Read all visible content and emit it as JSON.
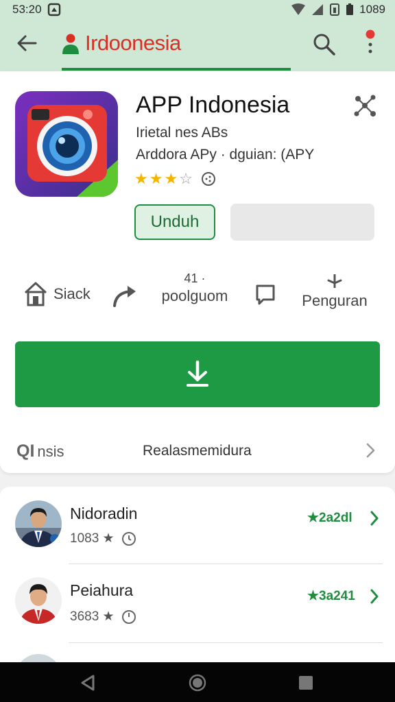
{
  "status_bar": {
    "time": "53:20",
    "battery": "1089"
  },
  "app_bar": {
    "title": "Irdoonesia"
  },
  "app": {
    "name": "APP Indonesia",
    "developer": "Irietal nes ABs",
    "category": "Arddora APy · dguian: (APY",
    "rating_stars": 3,
    "rating_max": 5,
    "install_button": "Unduh"
  },
  "actions": [
    {
      "label": "Siack",
      "icon": "home-icon"
    },
    {
      "top": "41 ·",
      "label": "poolguom",
      "icon": "share-arrow-icon"
    },
    {
      "icon": "comment-icon"
    },
    {
      "label": "Penguran",
      "icon": "pin-icon"
    }
  ],
  "details": {
    "left": "QI",
    "left_suffix": "nsis",
    "middle": "Realasmemidura"
  },
  "list": [
    {
      "name": "Nidoradin",
      "meta": "1083 ★",
      "rate": "★2a2dl"
    },
    {
      "name": "Peiahura",
      "meta": "3683 ★",
      "rate": "★3a241"
    }
  ],
  "colors": {
    "accent": "#1e9a45",
    "appbar": "#cfe8d6",
    "title": "#d93025"
  }
}
